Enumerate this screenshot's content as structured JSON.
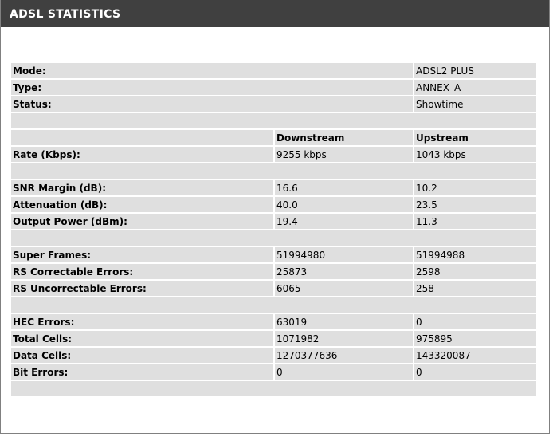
{
  "header": {
    "title": "ADSL STATISTICS"
  },
  "info": [
    {
      "label": "Mode:",
      "value": "ADSL2 PLUS"
    },
    {
      "label": "Type:",
      "value": "ANNEX_A"
    },
    {
      "label": "Status:",
      "value": "Showtime"
    }
  ],
  "columns": {
    "downstream": "Downstream",
    "upstream": "Upstream"
  },
  "rate": {
    "label": "Rate (Kbps):",
    "downstream": "9255 kbps",
    "upstream": "1043 kbps"
  },
  "line": [
    {
      "label": "SNR Margin (dB):",
      "downstream": "16.6",
      "upstream": "10.2"
    },
    {
      "label": "Attenuation (dB):",
      "downstream": "40.0",
      "upstream": "23.5"
    },
    {
      "label": "Output Power (dBm):",
      "downstream": "19.4",
      "upstream": "11.3"
    }
  ],
  "frames": [
    {
      "label": "Super Frames:",
      "downstream": "51994980",
      "upstream": "51994988"
    },
    {
      "label": "RS Correctable Errors:",
      "downstream": "25873",
      "upstream": "2598"
    },
    {
      "label": "RS Uncorrectable Errors:",
      "downstream": "6065",
      "upstream": "258"
    }
  ],
  "cells": [
    {
      "label": "HEC Errors:",
      "downstream": "63019",
      "upstream": "0"
    },
    {
      "label": "Total Cells:",
      "downstream": "1071982",
      "upstream": "975895"
    },
    {
      "label": "Data Cells:",
      "downstream": "1270377636",
      "upstream": "143320087"
    },
    {
      "label": "Bit Errors:",
      "downstream": "0",
      "upstream": "0"
    }
  ]
}
